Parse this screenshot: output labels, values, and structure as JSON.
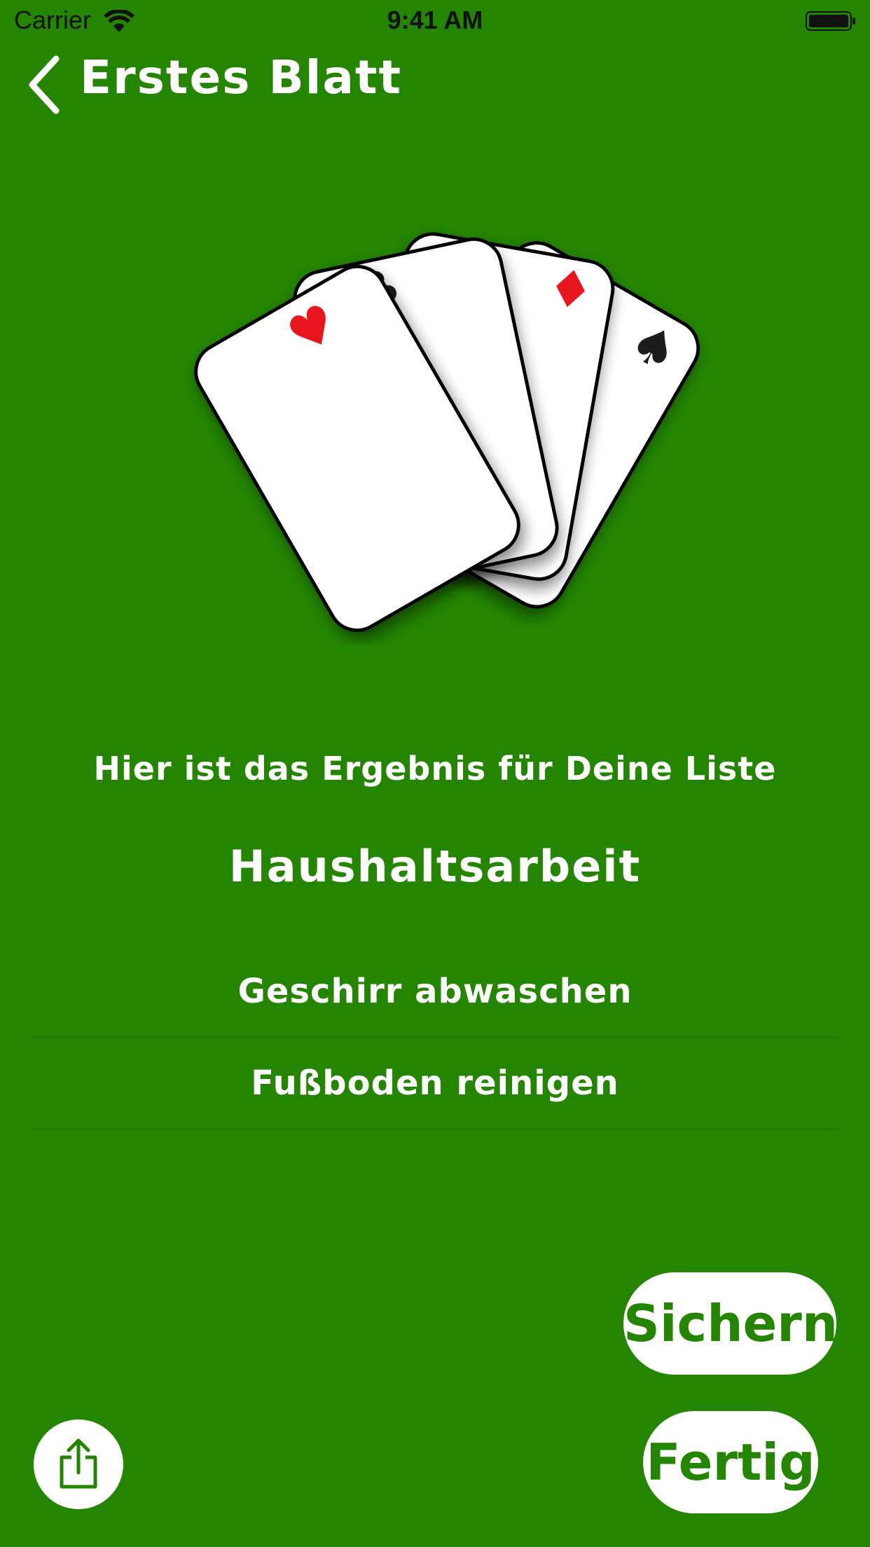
{
  "status_bar": {
    "carrier": "Carrier",
    "time": "9:41 AM"
  },
  "nav": {
    "back_icon": "chevron-left-icon",
    "title": "Erstes Blatt"
  },
  "illustration": {
    "cards": [
      "heart",
      "club",
      "diamond",
      "spade"
    ],
    "suit_symbols": [
      "♥",
      "♣",
      "♦",
      "♠"
    ]
  },
  "content": {
    "intro": "Hier ist das Ergebnis für Deine Liste",
    "list_name": "Haushaltsarbeit",
    "items": [
      "Geschirr abwaschen",
      "Fußboden reinigen"
    ]
  },
  "buttons": {
    "save_label": "Sichern",
    "done_label": "Fertig",
    "share_icon": "share-icon"
  },
  "colors": {
    "background": "#238500",
    "button_text": "#238500",
    "button_fill": "#ffffff",
    "heart": "#e8141c",
    "diamond": "#e8141c",
    "black_suit": "#1a1a1a"
  }
}
